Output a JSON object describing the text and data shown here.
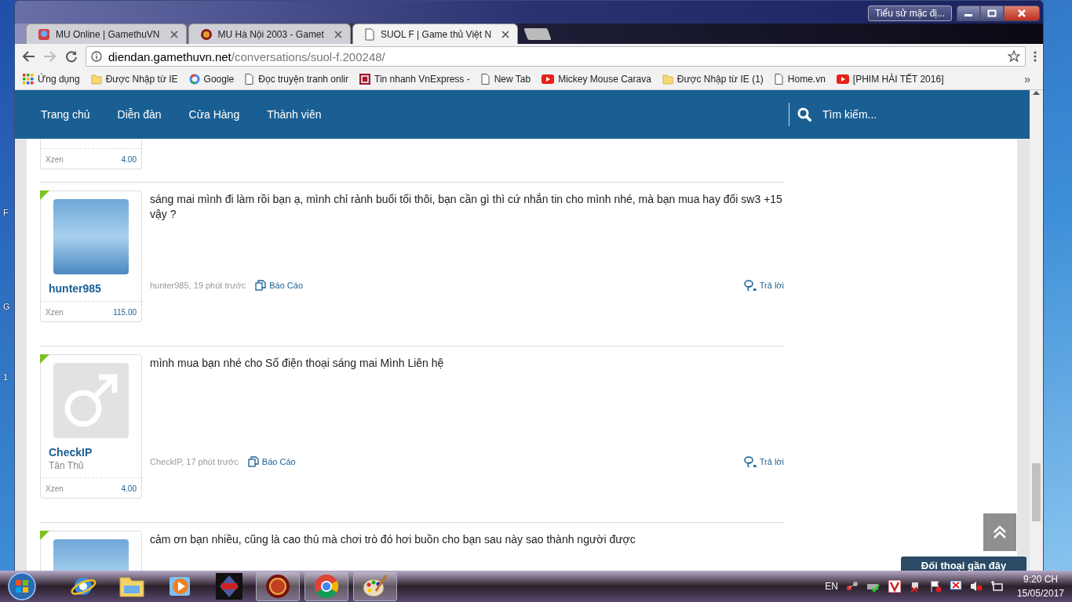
{
  "window": {
    "profile_button": "Tiểu sử mặc đị..."
  },
  "tabs": [
    {
      "title": "MU Online | GamethuVN",
      "kind": "avatar",
      "selected": false
    },
    {
      "title": "MU Hà Nội 2003 - Gamet",
      "kind": "round",
      "selected": false
    },
    {
      "title": "SUOL F | Game thủ Việt N",
      "kind": "page",
      "selected": true
    }
  ],
  "toolbar": {
    "back": {
      "disabled": false
    },
    "forward": {
      "disabled": true
    },
    "address": {
      "domain": "diendan.gamethuvn.net",
      "path": "/conversations/suol-f.200248/"
    }
  },
  "bookmarks": [
    {
      "label": "Ứng dụng",
      "kind": "apps"
    },
    {
      "label": "Được Nhập từ IE",
      "kind": "folder"
    },
    {
      "label": "Google",
      "kind": "google"
    },
    {
      "label": "Đọc truyện tranh onlir",
      "kind": "page"
    },
    {
      "label": "Tin nhanh VnExpress -",
      "kind": "news"
    },
    {
      "label": "New Tab",
      "kind": "page"
    },
    {
      "label": "Mickey Mouse Carava",
      "kind": "video"
    },
    {
      "label": "Được Nhập từ IE (1)",
      "kind": "folder"
    },
    {
      "label": "Home.vn",
      "kind": "page"
    },
    {
      "label": "[PHIM HÀI TẾT 2016]",
      "kind": "video"
    }
  ],
  "bookmarks_more": "»",
  "nav": {
    "items": [
      "Trang chủ",
      "Diễn đàn",
      "Cửa Hàng",
      "Thành viên"
    ],
    "search": {
      "placeholder": "Tìm kiếm..."
    }
  },
  "first_post_stub": {
    "xzen_label": "Xzen",
    "xzen_value": "4.00"
  },
  "posts": [
    {
      "kind": "photo",
      "username": "hunter985",
      "xzen_label": "Xzen",
      "xzen_value": "115.00",
      "message": "sáng mai mình đi làm rồi bạn ạ, mình chỉ rảnh buổi tối thôi, bạn cần gì thì cứ nhắn tin cho mình nhé, mà bạn mua hay đổi sw3 +15 vậy ?",
      "meta": "hunter985, 19 phút trước",
      "report": "Báo Cáo",
      "reply": "Trả lời"
    },
    {
      "kind": "male",
      "username": "CheckIP",
      "rank": "Tân Thủ",
      "xzen_label": "Xzen",
      "xzen_value": "4.00",
      "message": "mình mua bạn nhé cho Số điện thoại sáng mai Mình Liên hệ",
      "meta": "CheckIP, 17 phút trước",
      "report": "Báo Cáo",
      "reply": "Trả lời"
    }
  ],
  "last_post_partial": {
    "kind": "photo",
    "message": "cảm ơn bạn nhiều, cũng là cao thủ mà chơi trò đó hơi buồn cho bạn sau này sao thành người được"
  },
  "chat_tab": "Đối thoại gần đây",
  "desktop_labels": [
    "F",
    "G",
    "1"
  ],
  "taskbar": {
    "apps": [
      {
        "kind": "globe",
        "running": false
      },
      {
        "kind": "folder",
        "running": false
      },
      {
        "kind": "play",
        "running": false
      },
      {
        "kind": "game",
        "running": false
      },
      {
        "kind": "badge",
        "running": true
      },
      {
        "kind": "chrome",
        "running": true
      },
      {
        "kind": "palette",
        "running": true
      }
    ],
    "language": "EN",
    "time": "9:20 CH",
    "date": "15/05/2017"
  }
}
